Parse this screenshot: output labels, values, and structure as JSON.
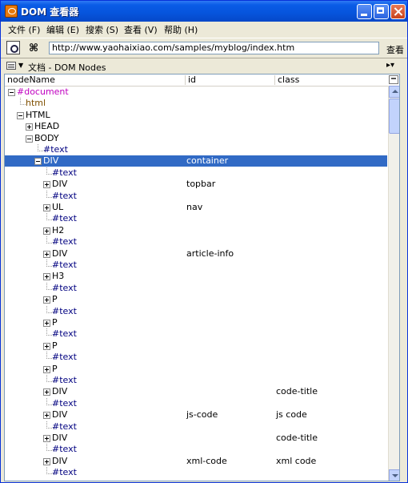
{
  "window": {
    "title": "DOM 查看器"
  },
  "menu": [
    {
      "label": "文件 (F)"
    },
    {
      "label": "编辑 (E)"
    },
    {
      "label": "搜索 (S)"
    },
    {
      "label": "查看 (V)"
    },
    {
      "label": "帮助 (H)"
    }
  ],
  "toolbar": {
    "url": "http://www.yaohaixiao.com/samples/myblog/index.htm",
    "go_label": "查看"
  },
  "panel": {
    "title": "文档 - DOM Nodes"
  },
  "columns": {
    "name": "nodeName",
    "id": "id",
    "class": "class"
  },
  "rows": [
    {
      "name": "#document",
      "id": "",
      "cls": ""
    },
    {
      "name": "html",
      "id": "",
      "cls": ""
    },
    {
      "name": "HTML",
      "id": "",
      "cls": ""
    },
    {
      "name": "HEAD",
      "id": "",
      "cls": ""
    },
    {
      "name": "BODY",
      "id": "",
      "cls": ""
    },
    {
      "name": "#text",
      "id": "",
      "cls": ""
    },
    {
      "name": "DIV",
      "id": "container",
      "cls": ""
    },
    {
      "name": "#text",
      "id": "",
      "cls": ""
    },
    {
      "name": "DIV",
      "id": "topbar",
      "cls": ""
    },
    {
      "name": "#text",
      "id": "",
      "cls": ""
    },
    {
      "name": "UL",
      "id": "nav",
      "cls": ""
    },
    {
      "name": "#text",
      "id": "",
      "cls": ""
    },
    {
      "name": "H2",
      "id": "",
      "cls": ""
    },
    {
      "name": "#text",
      "id": "",
      "cls": ""
    },
    {
      "name": "DIV",
      "id": "article-info",
      "cls": ""
    },
    {
      "name": "#text",
      "id": "",
      "cls": ""
    },
    {
      "name": "H3",
      "id": "",
      "cls": ""
    },
    {
      "name": "#text",
      "id": "",
      "cls": ""
    },
    {
      "name": "P",
      "id": "",
      "cls": ""
    },
    {
      "name": "#text",
      "id": "",
      "cls": ""
    },
    {
      "name": "P",
      "id": "",
      "cls": ""
    },
    {
      "name": "#text",
      "id": "",
      "cls": ""
    },
    {
      "name": "P",
      "id": "",
      "cls": ""
    },
    {
      "name": "#text",
      "id": "",
      "cls": ""
    },
    {
      "name": "P",
      "id": "",
      "cls": ""
    },
    {
      "name": "#text",
      "id": "",
      "cls": ""
    },
    {
      "name": "DIV",
      "id": "",
      "cls": "code-title"
    },
    {
      "name": "#text",
      "id": "",
      "cls": ""
    },
    {
      "name": "DIV",
      "id": "js-code",
      "cls": "js code"
    },
    {
      "name": "#text",
      "id": "",
      "cls": ""
    },
    {
      "name": "DIV",
      "id": "",
      "cls": "code-title"
    },
    {
      "name": "#text",
      "id": "",
      "cls": ""
    },
    {
      "name": "DIV",
      "id": "xml-code",
      "cls": "xml code"
    },
    {
      "name": "#text",
      "id": "",
      "cls": ""
    }
  ],
  "colors": {
    "selection": "#316ac5",
    "titlebar": "#0654dc"
  }
}
